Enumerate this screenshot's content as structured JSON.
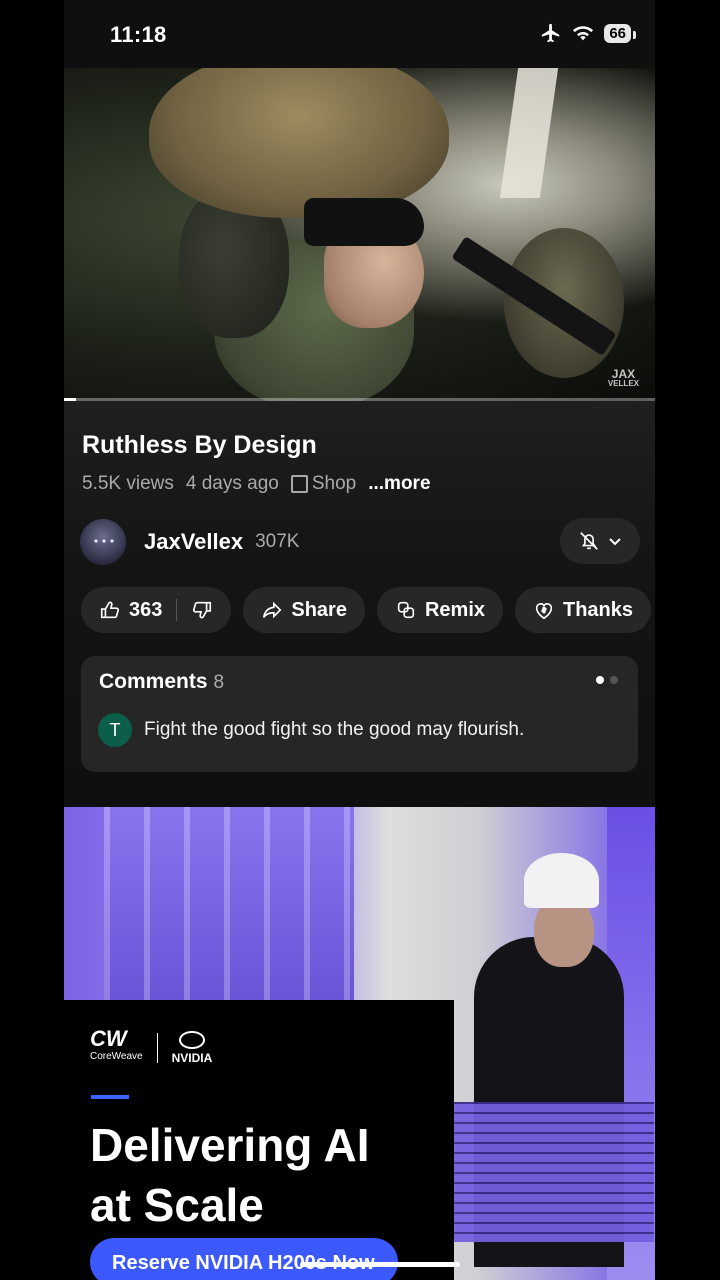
{
  "status_bar": {
    "time": "11:18",
    "battery": "66"
  },
  "video": {
    "watermark_line1": "JAX",
    "watermark_line2": "VELLEX",
    "progress": 0.02
  },
  "info": {
    "title": "Ruthless By Design",
    "views": "5.5K views",
    "age": "4 days ago",
    "shop": "Shop",
    "more": "...more"
  },
  "channel": {
    "name": "JaxVellex",
    "subscribers": "307K"
  },
  "actions": {
    "likes": "363",
    "share": "Share",
    "remix": "Remix",
    "thanks": "Thanks"
  },
  "comments": {
    "label": "Comments",
    "count": "8",
    "top": {
      "avatar_letter": "T",
      "text": "Fight the good fight so the good may flourish."
    }
  },
  "ad": {
    "brand1": "CoreWeave",
    "brand2": "NVIDIA",
    "headline_line1": "Delivering AI",
    "headline_line2": "at Scale",
    "cta": "Reserve NVIDIA H200s Now",
    "accent_color": "#3c59ff"
  }
}
